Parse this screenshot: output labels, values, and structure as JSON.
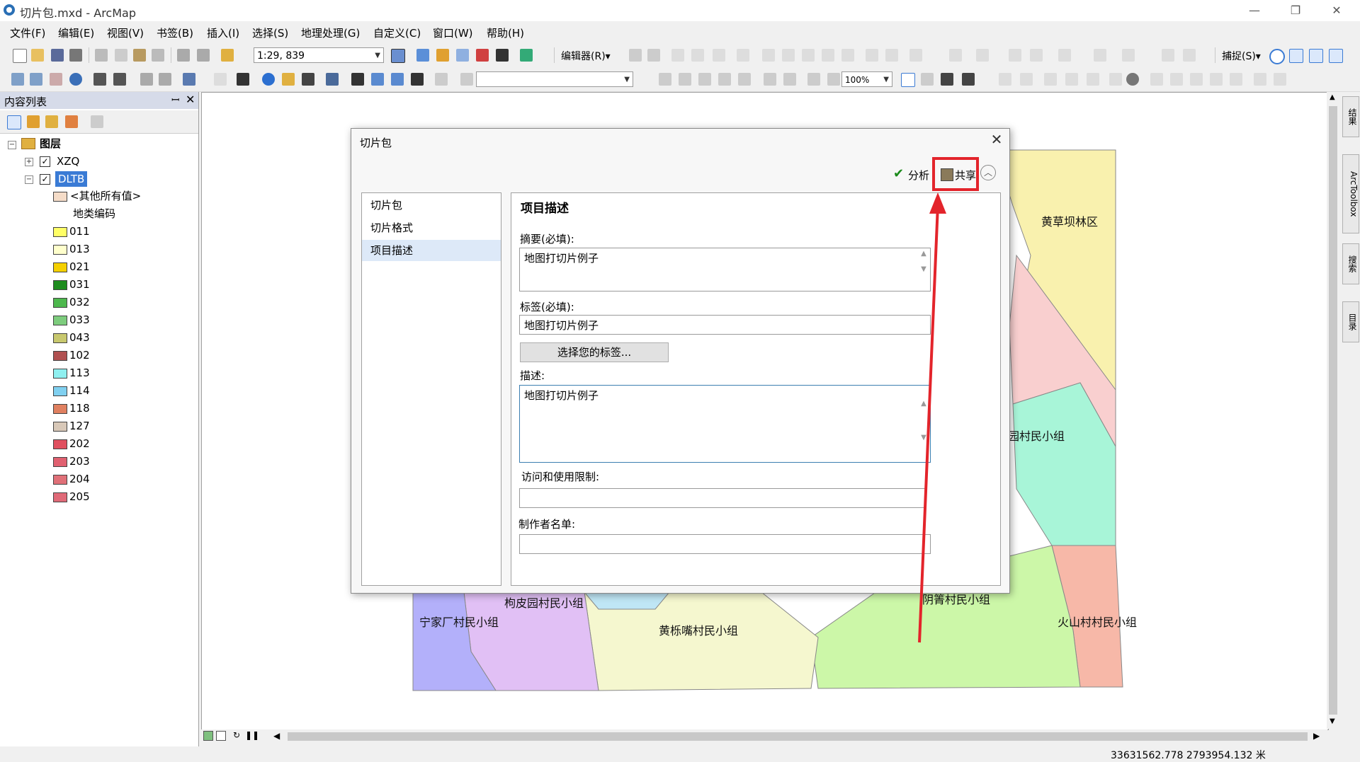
{
  "window": {
    "title": "切片包.mxd - ArcMap"
  },
  "menu": [
    "文件(F)",
    "编辑(E)",
    "视图(V)",
    "书签(B)",
    "插入(I)",
    "选择(S)",
    "地理处理(G)",
    "自定义(C)",
    "窗口(W)",
    "帮助(H)"
  ],
  "toolbar": {
    "scale": "1:29, 839",
    "editor_label": "编辑器(R)▾",
    "snap_label": "捕捉(S)▾",
    "zoom": "100%"
  },
  "toc": {
    "title": "内容列表",
    "root": "图层",
    "layers": [
      {
        "name": "XZQ",
        "checked": true
      },
      {
        "name": "DLTB",
        "checked": true
      }
    ],
    "other_values": "<其他所有值>",
    "field_heading": "地类编码",
    "classes": [
      {
        "code": "011",
        "color": "#ffff66"
      },
      {
        "code": "013",
        "color": "#ffffcc"
      },
      {
        "code": "021",
        "color": "#f5d000"
      },
      {
        "code": "031",
        "color": "#1e8c1e"
      },
      {
        "code": "032",
        "color": "#4db84d"
      },
      {
        "code": "033",
        "color": "#7dcc7d"
      },
      {
        "code": "043",
        "color": "#c8c86e"
      },
      {
        "code": "102",
        "color": "#b05050"
      },
      {
        "code": "113",
        "color": "#8ff0f0"
      },
      {
        "code": "114",
        "color": "#80d0f0"
      },
      {
        "code": "118",
        "color": "#e08060"
      },
      {
        "code": "127",
        "color": "#d8c8b8"
      },
      {
        "code": "202",
        "color": "#e05060"
      },
      {
        "code": "203",
        "color": "#e06070"
      },
      {
        "code": "204",
        "color": "#e07078"
      },
      {
        "code": "205",
        "color": "#e06a78"
      }
    ]
  },
  "map": {
    "labels": [
      "黄草坝林区",
      "园村民小组",
      "宁家厂村民小组",
      "枸皮园村民小组",
      "黄栎嘴村民小组",
      "阴箐村民小组",
      "火山村村民小组"
    ]
  },
  "dialog": {
    "title": "切片包",
    "analyze": "分析",
    "share": "共享",
    "nav": [
      "切片包",
      "切片格式",
      "项目描述"
    ],
    "section_title": "项目描述",
    "summary_label": "摘要(必填):",
    "summary_value": "地图打切片例子",
    "tags_label": "标签(必填):",
    "tags_value": "地图打切片例子",
    "choose_tags": "选择您的标签...",
    "desc_label": "描述:",
    "desc_value": "地图打切片例子",
    "access_label": "访问和使用限制:",
    "access_value": "",
    "credits_label": "制作者名单:",
    "credits_value": ""
  },
  "dock": [
    "结果",
    "ArcToolbox",
    "搜索",
    "目录"
  ],
  "status": {
    "coords": "33631562.778  2793954.132 米"
  }
}
